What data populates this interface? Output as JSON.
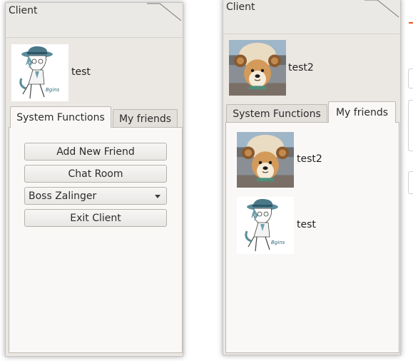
{
  "left_window": {
    "title": "Client",
    "profile": {
      "name": "test",
      "avatar": "sketch-boy-avatar"
    },
    "tabs": [
      {
        "label": "System Functions",
        "active": true
      },
      {
        "label": "My friends",
        "active": false
      }
    ],
    "buttons": {
      "add_friend": "Add New Friend",
      "chat_room": "Chat Room",
      "exit": "Exit Client"
    },
    "combo": {
      "selected": "Boss Zalinger"
    }
  },
  "right_window": {
    "title": "Client",
    "profile": {
      "name": "test2",
      "avatar": "shiba-dog-avatar"
    },
    "tabs": [
      {
        "label": "System Functions",
        "active": false
      },
      {
        "label": "My friends",
        "active": true
      }
    ],
    "friends": [
      {
        "name": "test2",
        "avatar": "shiba-dog-avatar"
      },
      {
        "name": "test",
        "avatar": "sketch-boy-avatar"
      }
    ]
  },
  "colors": {
    "window_bg": "#ebe8e4",
    "panel_bg": "#faf8f6",
    "accent": "#e95420"
  }
}
